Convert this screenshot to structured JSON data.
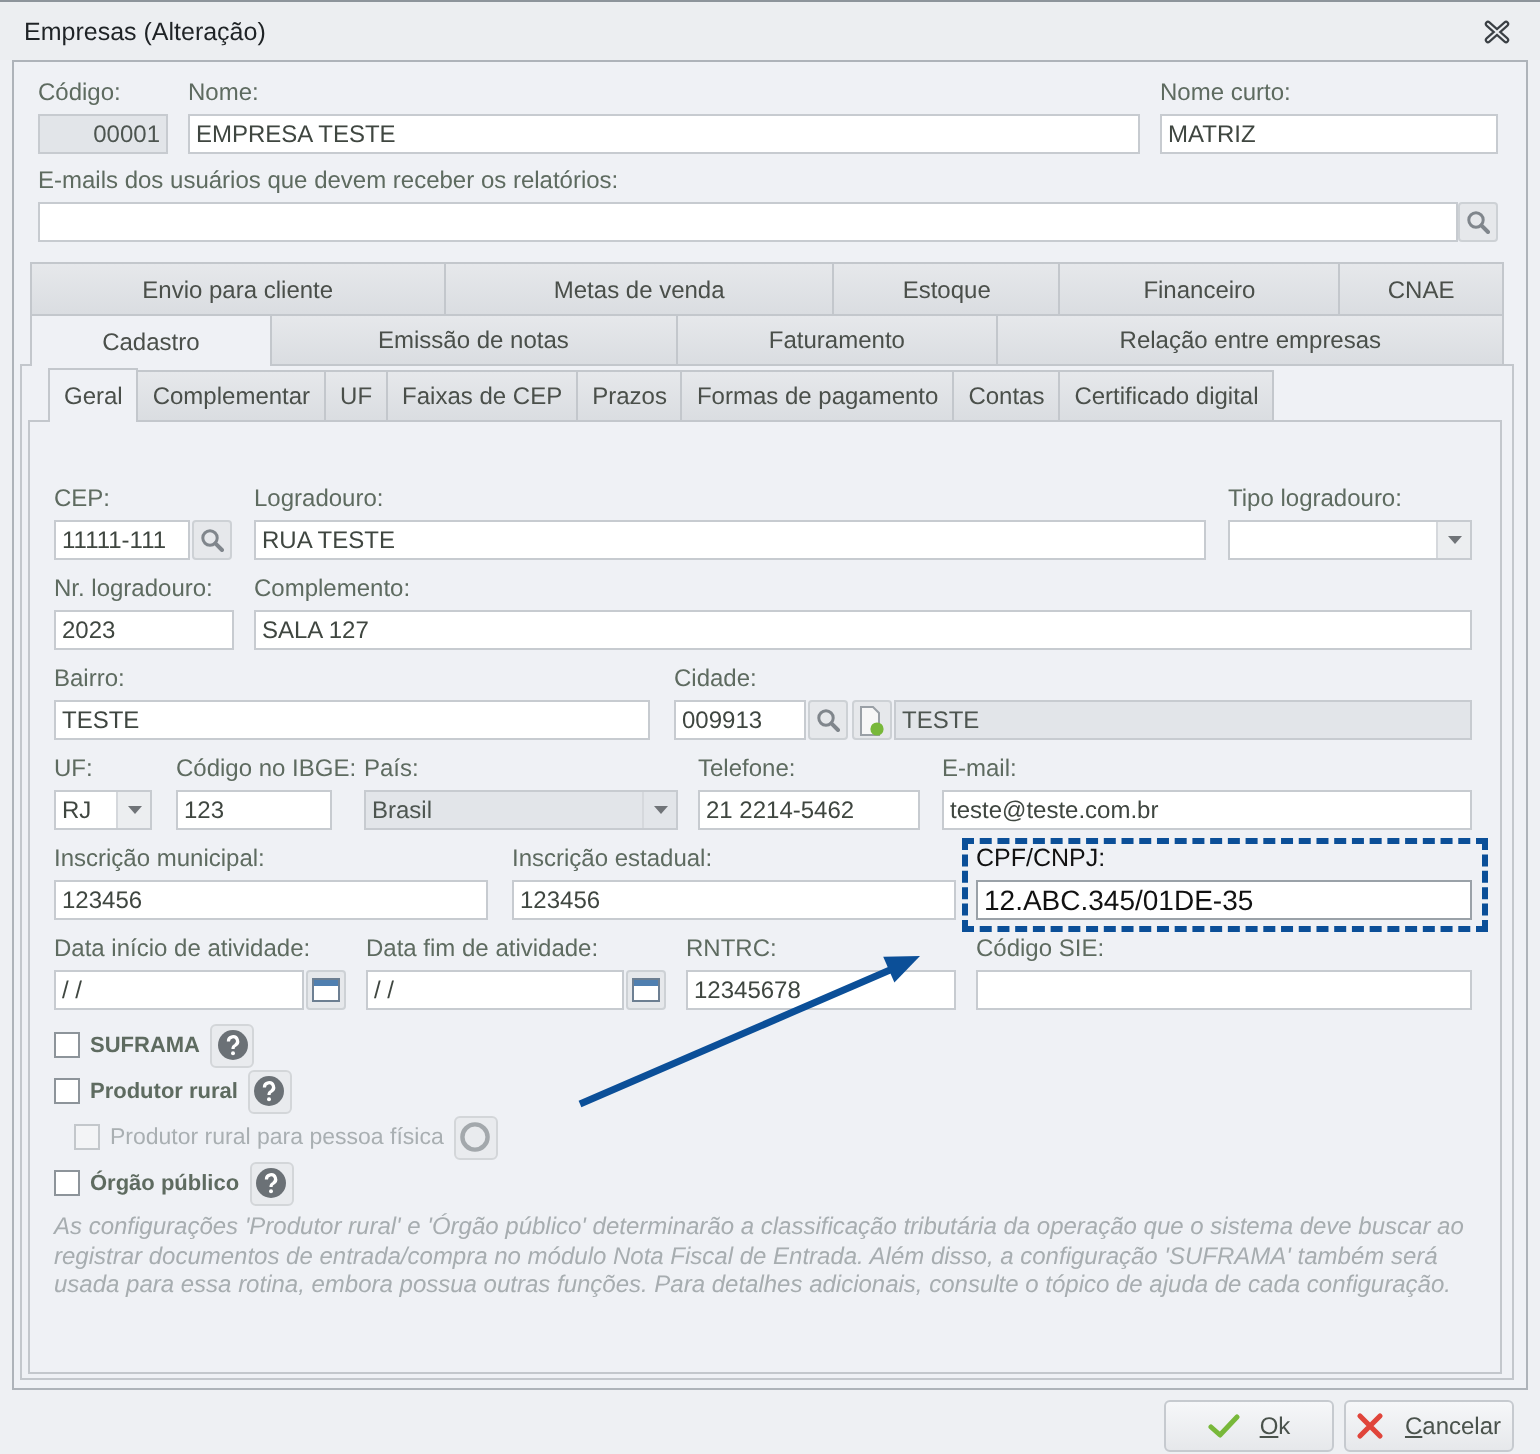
{
  "window": {
    "title": "Empresas (Alteração)"
  },
  "header": {
    "lines": [
      {
        "fields": [
          {
            "kind": "number",
            "label": "Código:",
            "value": "00001",
            "disabled": true
          },
          {
            "kind": "text",
            "label": "Nome:",
            "value": "EMPRESA TESTE",
            "disabled": false
          },
          {
            "kind": "text",
            "label": "Nome curto:",
            "value": "MATRIZ",
            "disabled": false
          }
        ]
      },
      {
        "fields": [
          {
            "kind": "search",
            "label": "E-mails dos usuários que devem receber os relatórios:",
            "disabled": false
          }
        ]
      }
    ]
  },
  "tabs": {
    "rows": [
      [
        {
          "label": "Envio para cliente",
          "selected": false
        },
        {
          "label": "Metas de venda",
          "selected": false
        },
        {
          "label": "Estoque",
          "selected": false
        },
        {
          "label": "Financeiro",
          "selected": false
        },
        {
          "label": "CNAE",
          "selected": false
        }
      ],
      [
        {
          "label": "Cadastro",
          "selected": true
        },
        {
          "label": "Emissão de notas",
          "selected": false
        },
        {
          "label": "Faturamento",
          "selected": false
        },
        {
          "label": "Relação entre empresas",
          "selected": false
        }
      ]
    ]
  },
  "subtabs": [
    {
      "label": "Geral",
      "selected": true
    },
    {
      "label": "Complementar",
      "selected": false
    },
    {
      "label": "UF",
      "selected": false
    },
    {
      "label": "Faixas de CEP",
      "selected": false
    },
    {
      "label": "Prazos",
      "selected": false
    },
    {
      "label": "Formas de pagamento",
      "selected": false
    },
    {
      "label": "Contas",
      "selected": false
    },
    {
      "label": "Certificado digital",
      "selected": false
    }
  ],
  "form": {
    "lines": [
      {
        "fields": [
          {
            "kind": "search",
            "label": "CEP:",
            "value": "11111-111",
            "disabled": false
          },
          {
            "kind": "text",
            "label": "Logradouro:",
            "value": "RUA TESTE",
            "disabled": false
          },
          {
            "kind": "combo",
            "label": "Tipo logradouro:",
            "disabled": false
          }
        ]
      },
      {
        "fields": [
          {
            "kind": "text",
            "label": "Nr. logradouro:",
            "value": "2023",
            "disabled": false
          },
          {
            "kind": "text",
            "label": "Complemento:",
            "value": "SALA 127",
            "disabled": false
          }
        ]
      },
      {
        "fields": [
          {
            "kind": "text",
            "label": "Bairro:",
            "value": "TESTE",
            "disabled": false
          },
          {
            "kind": "city",
            "label": "Cidade:",
            "value": "009913",
            "disabled": false
          },
          {
            "kind": "text",
            "value": "TESTE",
            "disabled": true
          }
        ]
      },
      {
        "fields": [
          {
            "kind": "combo",
            "label": "UF:",
            "value": "RJ",
            "disabled": false
          },
          {
            "kind": "text",
            "label": "Código no IBGE:",
            "value": "123",
            "disabled": false
          },
          {
            "kind": "combo",
            "label": "País:",
            "value": "Brasil",
            "disabled": true
          },
          {
            "kind": "text",
            "label": "Telefone:",
            "value": "21 2214-5462",
            "disabled": false
          },
          {
            "kind": "text",
            "label": "E-mail:",
            "value": "teste@teste.com.br",
            "disabled": false
          }
        ]
      },
      {
        "fields": [
          {
            "kind": "text",
            "label": "Inscrição municipal:",
            "value": "123456",
            "disabled": false
          },
          {
            "kind": "text",
            "label": "Inscrição estadual:",
            "value": "123456",
            "disabled": false
          },
          {
            "kind": "highlighted",
            "label": "CPF/CNPJ:",
            "value": "12.ABC.345/01DE-35",
            "disabled": false
          }
        ]
      },
      {
        "fields": [
          {
            "kind": "date",
            "label": "Data início de atividade:",
            "value": "/ /",
            "disabled": false
          },
          {
            "kind": "date",
            "label": "Data fim de atividade:",
            "value": "/ /",
            "disabled": false
          },
          {
            "kind": "text",
            "label": "RNTRC:",
            "value": "12345678",
            "disabled": false
          },
          {
            "kind": "text",
            "label": "Código SIE:",
            "disabled": false
          }
        ]
      }
    ]
  },
  "options": [
    {
      "label": "SUFRAMA",
      "checked": false,
      "disabled": false
    },
    {
      "label": "Produtor rural",
      "checked": false,
      "disabled": false,
      "children": [
        {
          "label": "Produtor rural para pessoa física",
          "checked": false,
          "disabled": true
        }
      ]
    },
    {
      "label": "Órgão público",
      "checked": false,
      "disabled": false
    }
  ],
  "note": "As configurações 'Produtor rural' e 'Órgão público' determinarão a classificação tributária da operação que o sistema deve buscar ao registrar documentos de entrada/compra no módulo Nota Fiscal de Entrada. Além disso, a configuração 'SUFRAMA' também será usada para essa rotina, embora possua outras funções. Para detalhes adicionais, consulte o tópico de ajuda de cada configuração.",
  "buttons": [
    {
      "kind": "ok",
      "label": "Ok"
    },
    {
      "kind": "cancel",
      "label": "Cancelar"
    }
  ]
}
